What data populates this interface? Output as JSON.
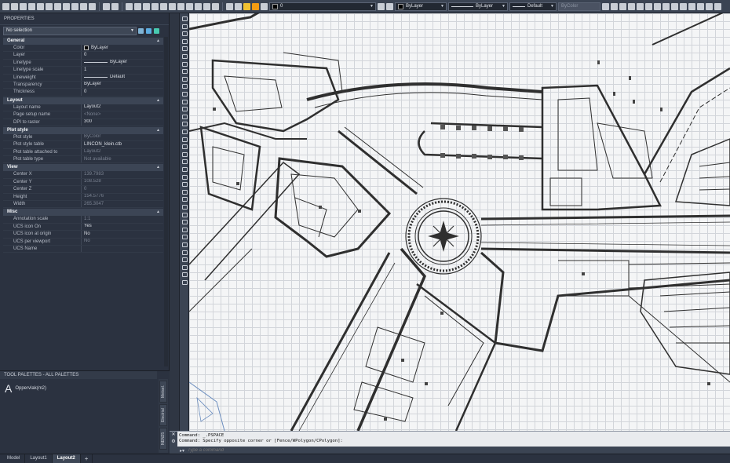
{
  "toolbar": {
    "layer_value": "0",
    "color_value": "ByLayer",
    "linetype_value": "ByLayer",
    "lineweight_value": "Default",
    "plotstyle_value": "ByColor"
  },
  "properties": {
    "title": "PROPERTIES",
    "selection": "No selection",
    "categories": [
      {
        "name": "General",
        "rows": [
          {
            "key": "Color",
            "value": "ByLayer",
            "swatch": "#000000"
          },
          {
            "key": "Layer",
            "value": "0"
          },
          {
            "key": "Linetype",
            "value": "ByLayer",
            "line": true
          },
          {
            "key": "Linetype scale",
            "value": "1"
          },
          {
            "key": "Lineweight",
            "value": "Default",
            "line": true
          },
          {
            "key": "Transparency",
            "value": "ByLayer"
          },
          {
            "key": "Thickness",
            "value": "0"
          }
        ]
      },
      {
        "name": "Layout",
        "rows": [
          {
            "key": "Layout name",
            "value": "Layout2"
          },
          {
            "key": "Page setup name",
            "value": "<None>",
            "dim": true
          },
          {
            "key": "DPI to raster",
            "value": "300"
          }
        ]
      },
      {
        "name": "Plot style",
        "rows": [
          {
            "key": "Plot style",
            "value": "ByColor",
            "dim": true
          },
          {
            "key": "Plot style table",
            "value": "LINCON_klein.ctb"
          },
          {
            "key": "Plot table attached to",
            "value": "Layout2",
            "dim": true
          },
          {
            "key": "Plot table type",
            "value": "Not available",
            "dim": true
          }
        ]
      },
      {
        "name": "View",
        "rows": [
          {
            "key": "Center X",
            "value": "139.7983",
            "dim": true
          },
          {
            "key": "Center Y",
            "value": "108.528",
            "dim": true
          },
          {
            "key": "Center Z",
            "value": "0",
            "dim": true
          },
          {
            "key": "Height",
            "value": "154.5776",
            "dim": true
          },
          {
            "key": "Width",
            "value": "265.3047",
            "dim": true
          }
        ]
      },
      {
        "name": "Misc",
        "rows": [
          {
            "key": "Annotation scale",
            "value": "1:1",
            "dim": true
          },
          {
            "key": "UCS icon On",
            "value": "Yes"
          },
          {
            "key": "UCS icon at origin",
            "value": "No"
          },
          {
            "key": "UCS per viewport",
            "value": "No",
            "dim": true
          },
          {
            "key": "UCS Name",
            "value": ""
          }
        ]
      }
    ]
  },
  "tool_palette": {
    "title": "TOOL PALETTES - ALL PALETTES",
    "item_icon": "A",
    "item_label": "Oppervlak(m2)",
    "tabs": [
      "Metsel.",
      "Electrial",
      "NEN25"
    ]
  },
  "command": {
    "history": [
      "Command: _.PSPACE",
      "Command: Specify opposite corner or [Fence/WPolygon/CPolygon]:"
    ],
    "placeholder": "Type a command",
    "close_glyph": "✕",
    "wrench_glyph": "⚙"
  },
  "layout_tabs": [
    {
      "label": "Model",
      "active": false
    },
    {
      "label": "Layout1",
      "active": false
    },
    {
      "label": "Layout2",
      "active": true
    },
    {
      "label": "+",
      "active": false
    }
  ],
  "colors": {
    "panel": "#2b3240",
    "toolbar": "#3b4453",
    "canvas": "#f4f5f6",
    "grid": "#d2d5da",
    "wall": "#3a3a3a"
  }
}
